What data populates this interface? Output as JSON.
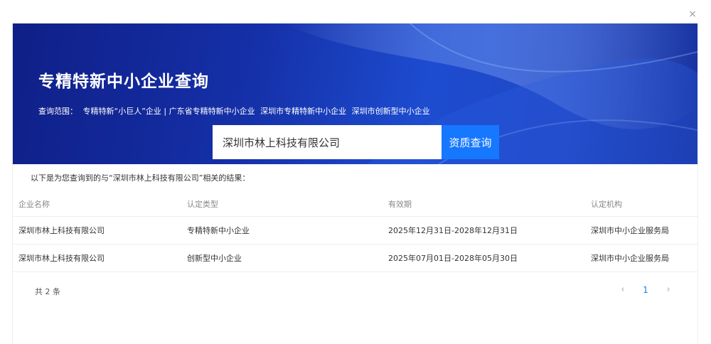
{
  "dialog": {
    "close_symbol": "×"
  },
  "banner": {
    "title": "专精特新中小企业查询",
    "scope_label": "查询范围：",
    "scope_items": [
      "专精特新“小巨人”企业 | 广东省专精特新中小企业",
      "深圳市专精特新中小企业",
      "深圳市创新型中小企业"
    ]
  },
  "search": {
    "value": "深圳市林上科技有限公司",
    "button_label": "资质查询"
  },
  "results": {
    "note": "以下是为您查询到的与“深圳市林上科技有限公司”相关的结果：",
    "columns": [
      "企业名称",
      "认定类型",
      "有效期",
      "认定机构"
    ],
    "rows": [
      [
        "深圳市林上科技有限公司",
        "专精特新中小企业",
        "2025年12月31日-2028年12月31日",
        "深圳市中小企业服务局"
      ],
      [
        "深圳市林上科技有限公司",
        "创新型中小企业",
        "2025年07月01日-2028年05月30日",
        "深圳市中小企业服务局"
      ]
    ]
  },
  "pagination": {
    "total_text": "共 2 条",
    "prev_symbol": "‹",
    "current_page": "1",
    "next_symbol": "›"
  }
}
